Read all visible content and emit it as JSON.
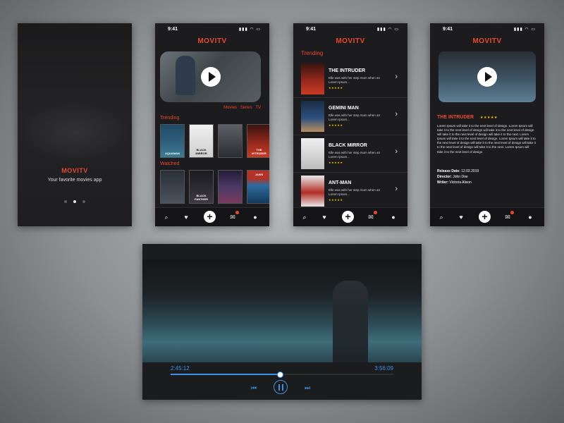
{
  "status": {
    "time": "9:41"
  },
  "splash": {
    "brand": "MOVITV",
    "tagline": "Your favorite movies app",
    "dots": [
      "dot-1",
      "dot-2",
      "dot-3"
    ],
    "active_dot": 1
  },
  "home": {
    "brand": "MOVITV",
    "filters": [
      "Movies",
      "Series",
      "TV"
    ],
    "trending_label": "Trending",
    "watched_label": "Watched",
    "trending": [
      {
        "title": "AQUAMAN",
        "color": "#2f5e7a"
      },
      {
        "title": "BLACK MIRROR",
        "color": "#d9d9d9"
      },
      {
        "title": "",
        "color": "#40444a"
      },
      {
        "title": "THE INTRUDER",
        "color": "#9c2a1c"
      }
    ],
    "watched": [
      {
        "title": "",
        "color": "#38404a"
      },
      {
        "title": "BLACK PANTHER",
        "color": "#2d2b33"
      },
      {
        "title": "",
        "color": "#4a3a64"
      },
      {
        "title": "JAWS",
        "color": "#2b6c9e"
      }
    ]
  },
  "trending": {
    "brand": "MOVITV",
    "label": "Trending",
    "items": [
      {
        "title": "THE INTRUDER",
        "desc": "Elle was with her step mum when an Lorem Ipsum...",
        "stars": "★★★★★",
        "color": "#9c2a1c"
      },
      {
        "title": "GEMINI MAN",
        "desc": "Elle was with her step mum when an Lorem Ipsum...",
        "stars": "★★★★★",
        "color": "#2b4f7d"
      },
      {
        "title": "BLACK MIRROR",
        "desc": "Elle was with her step mum when an Lorem Ipsum...",
        "stars": "★★★★★",
        "color": "#d9d9d9"
      },
      {
        "title": "ANT-MAN",
        "desc": "Elle was with her step mum when an Lorem Ipsum...",
        "stars": "★★★★★",
        "color": "#b22c25"
      }
    ]
  },
  "detail": {
    "brand": "MOVITV",
    "title": "THE INTRUDER",
    "stars": "★★★★★",
    "body": "Lorem Ipsum will take it to the next level of design. Lorem Ipsum will take it to the next level of design will take it to the next level of design will take it to the next level of design will take it to the next. Lorem Ipsum will take it to the next level of design. Lorem Ipsum will take it to the next level of design will take it to the next level of design will take it to the next level of design will take it to the next. Lorem Ipsum will take it to the next level of design.",
    "release_label": "Release Date:",
    "release_value": "12.02.2019",
    "director_label": "Director:",
    "director_value": "John Doe",
    "writer_label": "Writer:",
    "writer_value": "Victoria Alison"
  },
  "player": {
    "elapsed": "2:45:12",
    "total": "3:56:09",
    "progress_fraction": 0.49
  },
  "tabbar": {
    "icons": [
      "search-icon",
      "heart-icon",
      "add-icon",
      "mail-icon",
      "profile-icon"
    ]
  }
}
